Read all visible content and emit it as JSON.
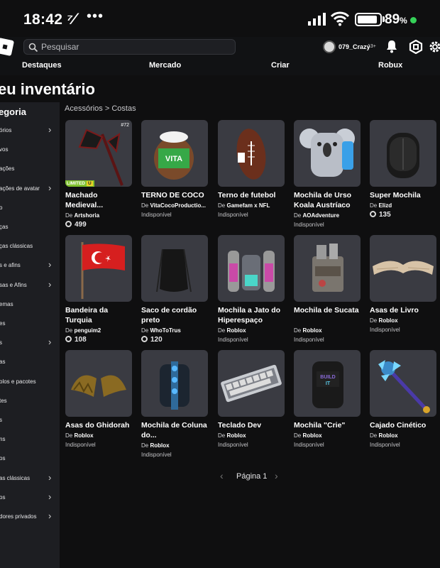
{
  "status_bar": {
    "time": "18:42",
    "app_glyph": "⁷⁄",
    "dots": "•••",
    "battery_percent": "89",
    "battery_level": 0.89
  },
  "header": {
    "search_placeholder": "Pesquisar",
    "username": "079_Crazy",
    "age_label": "13+"
  },
  "nav": {
    "items": [
      "Destaques",
      "Mercado",
      "Criar",
      "Robux"
    ]
  },
  "page": {
    "title": "eu inventário"
  },
  "sidebar": {
    "heading": "egoria",
    "items": [
      {
        "label": "órios",
        "chevron": true
      },
      {
        "label": "vos",
        "chevron": false
      },
      {
        "label": "ações",
        "chevron": false
      },
      {
        "label": "ações de avatar",
        "chevron": true
      },
      {
        "label": "o",
        "chevron": false
      },
      {
        "label": "ças",
        "chevron": false
      },
      {
        "label": "ças clássicas",
        "chevron": false
      },
      {
        "label": "s e afins",
        "chevron": true
      },
      {
        "label": "sas e Afins",
        "chevron": true
      },
      {
        "label": "emas",
        "chevron": false
      },
      {
        "label": "es",
        "chevron": false
      },
      {
        "label": "s",
        "chevron": true
      },
      {
        "label": "as",
        "chevron": false
      },
      {
        "label": "olos e pacotes",
        "chevron": false
      },
      {
        "label": "tes",
        "chevron": false
      },
      {
        "label": "s",
        "chevron": false
      },
      {
        "label": "ns",
        "chevron": false
      },
      {
        "label": "os",
        "chevron": false
      },
      {
        "label": "as clássicas",
        "chevron": true
      },
      {
        "label": "os",
        "chevron": true
      },
      {
        "label": "dores privados",
        "chevron": true
      },
      {
        "label": "",
        "chevron": false
      },
      {
        "label": "",
        "chevron": false
      }
    ]
  },
  "breadcrumb": {
    "text": "Acessórios > Costas"
  },
  "labels": {
    "by": "De",
    "limited": "LIMITED",
    "limited_u": "U",
    "serial_badge": "#72"
  },
  "items": [
    {
      "name": "Machado Medieval...",
      "creator": "Artshoria",
      "price": "499",
      "status": "",
      "limited": true,
      "art": "axe"
    },
    {
      "name": "TERNO DE COCO",
      "creator": "VitaCocoProductio...",
      "price": "",
      "status": "Indisponível",
      "limited": false,
      "art": "coconut"
    },
    {
      "name": "Terno de futebol",
      "creator": "Gamefam x NFL",
      "price": "",
      "status": "Indisponível",
      "limited": false,
      "art": "football"
    },
    {
      "name": "Mochila de Urso Koala Austríaco",
      "creator": "AOAdventure",
      "price": "",
      "status": "Indisponível",
      "limited": false,
      "art": "koala"
    },
    {
      "name": "Super Mochila",
      "creator": "Elizd",
      "price": "135",
      "status": "",
      "limited": false,
      "art": "backpack-black"
    },
    {
      "name": "Bandeira da Turquia",
      "creator": "penguim2",
      "price": "108",
      "status": "",
      "limited": false,
      "art": "flag"
    },
    {
      "name": "Saco de cordão preto",
      "creator": "WhoToTrus",
      "price": "120",
      "status": "",
      "limited": false,
      "art": "drawstring"
    },
    {
      "name": "Mochila a Jato do Hiperespaço",
      "creator": "Roblox",
      "price": "",
      "status": "Indisponível",
      "limited": false,
      "art": "jetpack"
    },
    {
      "name": "Mochila de Sucata",
      "creator": "Roblox",
      "price": "",
      "status": "Indisponível",
      "limited": false,
      "art": "scrap"
    },
    {
      "name": "Asas de Livro",
      "creator": "Roblox",
      "price": "",
      "status": "Indisponível",
      "limited": false,
      "art": "bookwings"
    },
    {
      "name": "Asas do Ghidorah",
      "creator": "Roblox",
      "price": "",
      "status": "Indisponível",
      "limited": false,
      "art": "ghidorah"
    },
    {
      "name": "Mochila de Coluna do...",
      "creator": "Roblox",
      "price": "",
      "status": "Indisponível",
      "limited": false,
      "art": "spine"
    },
    {
      "name": "Teclado Dev",
      "creator": "Roblox",
      "price": "",
      "status": "Indisponível",
      "limited": false,
      "art": "keyboard"
    },
    {
      "name": "Mochila \"Crie\"",
      "creator": "Roblox",
      "price": "",
      "status": "Indisponível",
      "limited": false,
      "art": "crie"
    },
    {
      "name": "Cajado Cinético",
      "creator": "Roblox",
      "price": "",
      "status": "Indisponível",
      "limited": false,
      "art": "staff"
    }
  ],
  "pagination": {
    "label": "Página 1",
    "prev": "‹",
    "next": "›"
  },
  "colors": {
    "background": "#0f0f10",
    "sidebar": "#1d1e22",
    "thumb": "#3a3b42",
    "status_dot": "#35d158",
    "limited_green": "#7fc12e"
  }
}
